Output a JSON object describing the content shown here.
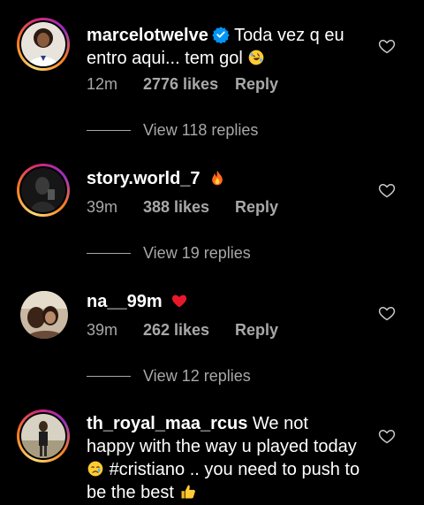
{
  "comments": [
    {
      "username": "marcelotwelve",
      "verified": true,
      "text": "Toda vez q eu entro aqui... tem gol",
      "emoji": "rolling-laughing-emoji",
      "time": "12m",
      "likes": "2776 likes",
      "reply": "Reply",
      "view_replies": "View 118 replies",
      "has_story": true
    },
    {
      "username": "story.world_7",
      "verified": false,
      "text": "",
      "emoji": "fire-emoji",
      "time": "39m",
      "likes": "388 likes",
      "reply": "Reply",
      "view_replies": "View 19 replies",
      "has_story": true
    },
    {
      "username": "na__99m",
      "verified": false,
      "text": "",
      "emoji": "red-heart-emoji",
      "time": "39m",
      "likes": "262 likes",
      "reply": "Reply",
      "view_replies": "View 12 replies",
      "has_story": false
    },
    {
      "username": "th_royal_maa_rcus",
      "verified": false,
      "text_part1": "We not happy with the way u played today",
      "text_part2": "#cristiano .. you need to push to be the best",
      "emoji1": "crying-face-emoji",
      "emoji2": "thumbs-up-emoji",
      "has_story": true
    }
  ],
  "colors": {
    "background": "#000000",
    "text": "#ffffff",
    "muted": "#a8a8a8",
    "verified": "#0095f6"
  },
  "icons": {
    "like": "heart-outline-icon",
    "verified": "verified-badge-icon"
  }
}
